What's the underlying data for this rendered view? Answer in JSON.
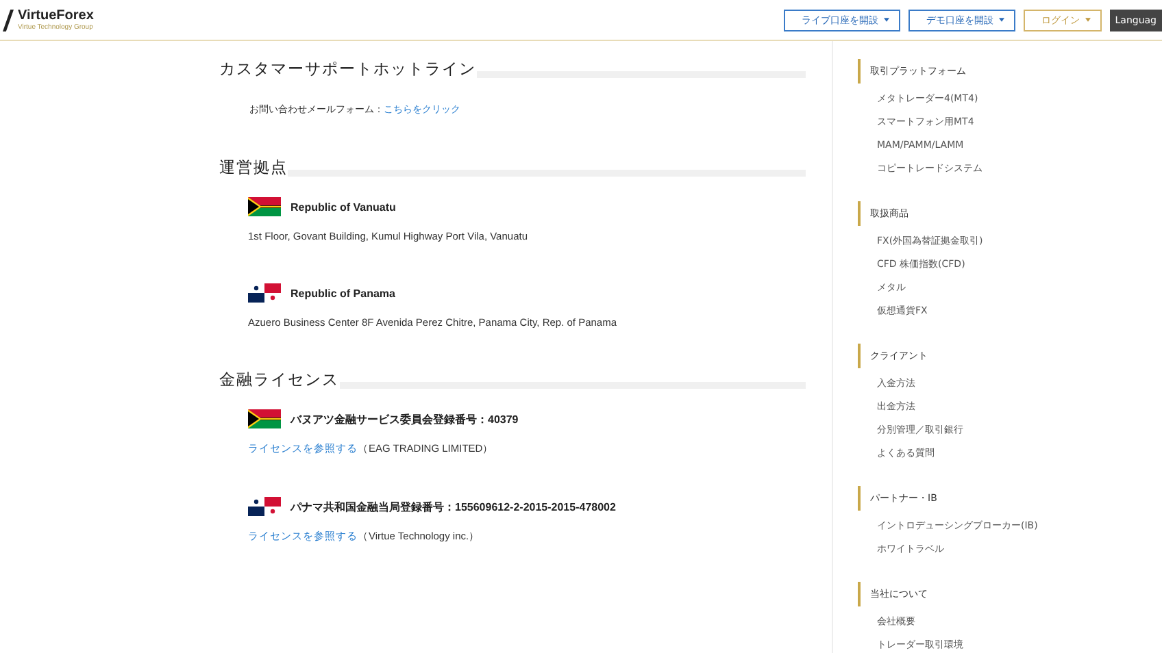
{
  "header": {
    "logo": {
      "name": "VirtueForex",
      "tagline": "Virtue Technology Group"
    },
    "buttons": [
      {
        "label": "ライブ口座を開設",
        "kind": "blue"
      },
      {
        "label": "デモ口座を開設",
        "kind": "blue"
      },
      {
        "label": "ログイン",
        "kind": "gold"
      },
      {
        "label": "Languag",
        "kind": "dark"
      }
    ]
  },
  "sections": [
    {
      "title": "カスタマーサポートホットライン",
      "kind": "contact",
      "text": "お問い合わせメールフォーム：",
      "link": "こちらをクリック"
    },
    {
      "title": "運営拠点",
      "kind": "offices",
      "items": [
        {
          "kind": "vanuatu",
          "name": "Republic of Vanuatu",
          "text": "1st Floor, Govant Building, Kumul Highway Port Vila, Vanuatu"
        },
        {
          "kind": "panama",
          "name": "Republic of Panama",
          "text": "Azuero Business Center 8F Avenida Perez Chitre, Panama City, Rep. of Panama"
        }
      ]
    },
    {
      "title": "金融ライセンス",
      "kind": "licenses",
      "items": [
        {
          "kind": "vanuatu",
          "name": "バヌアツ金融サービス委員会登録番号：40379",
          "link": "ライセンスを参照する",
          "text": "（EAG TRADING LIMITED）"
        },
        {
          "kind": "panama",
          "name": "パナマ共和国金融当局登録番号：155609612-2-2015-2015-478002",
          "link": "ライセンスを参照する",
          "text": "（Virtue Technology inc.）"
        }
      ]
    }
  ],
  "sidebar": [
    {
      "heading": "取引プラットフォーム",
      "items": [
        "メタトレーダー4(MT4)",
        "スマートフォン用MT4",
        "MAM/PAMM/LAMM",
        "コピートレードシステム"
      ]
    },
    {
      "heading": "取扱商品",
      "items": [
        "FX(外国為替証拠金取引)",
        "CFD 株価指数(CFD)",
        "メタル",
        "仮想通貨FX"
      ]
    },
    {
      "heading": "クライアント",
      "items": [
        "入金方法",
        "出金方法",
        "分別管理／取引銀行",
        "よくある質問"
      ]
    },
    {
      "heading": "パートナー・IB",
      "items": [
        "イントロデューシングブローカー(IB)",
        "ホワイトラベル"
      ]
    },
    {
      "heading": "当社について",
      "items": [
        "会社概要",
        "トレーダー取引環境"
      ]
    }
  ]
}
